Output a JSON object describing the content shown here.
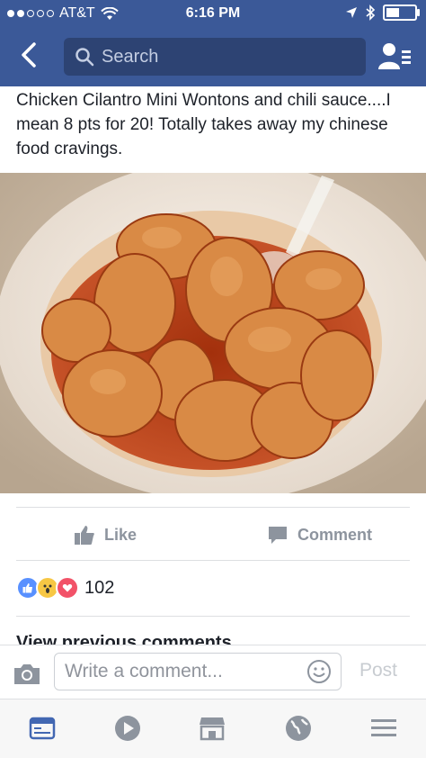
{
  "status_bar": {
    "carrier": "AT&T",
    "time": "6:16 PM"
  },
  "header": {
    "search_placeholder": "Search"
  },
  "post": {
    "text": "Chicken Cilantro Mini Wontons and chili sauce....I mean 8 pts for 20! Totally takes away my chinese food cravings.",
    "photo_subject": "wontons-in-chili-sauce"
  },
  "actions": {
    "like_label": "Like",
    "comment_label": "Comment"
  },
  "reactions": {
    "count": "102",
    "types": [
      "like",
      "wow",
      "love"
    ]
  },
  "comments": {
    "view_previous": "View previous comments"
  },
  "composer": {
    "placeholder": "Write a comment...",
    "post_label": "Post"
  },
  "tabs": [
    "news-feed",
    "video",
    "marketplace",
    "notifications-globe",
    "menu"
  ],
  "colors": {
    "brand": "#3b5998",
    "text": "#1d2129",
    "muted": "#8d949e"
  }
}
